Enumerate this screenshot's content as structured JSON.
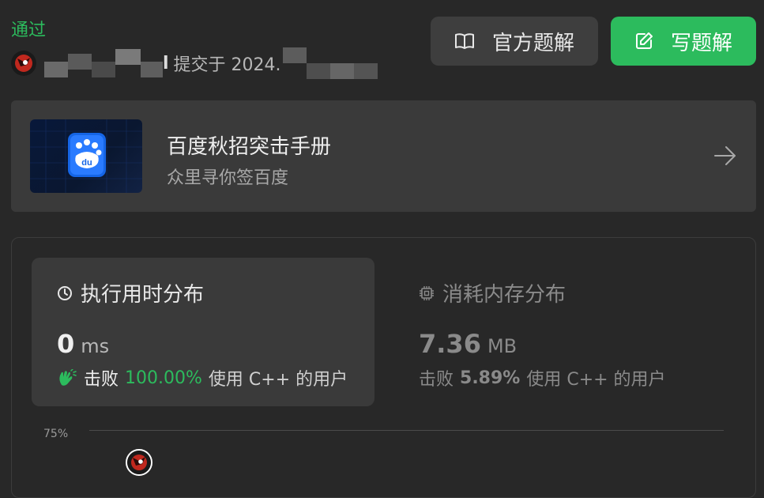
{
  "status": "通过",
  "submission": {
    "prefix": "l",
    "text": "提交于 2024."
  },
  "buttons": {
    "official": "官方题解",
    "write": "写题解"
  },
  "banner": {
    "title": "百度秋招突击手册",
    "subtitle": "众里寻你签百度",
    "logo_text": "du"
  },
  "runtime": {
    "title": "执行用时分布",
    "value": "0",
    "unit": "ms",
    "beat_label": "击败",
    "beat_pct": "100.00%",
    "beat_suffix": "使用 C++ 的用户"
  },
  "memory": {
    "title": "消耗内存分布",
    "value": "7.36",
    "unit": "MB",
    "beat_label": "击败",
    "beat_pct": "5.89%",
    "beat_suffix": "使用 C++ 的用户"
  },
  "chart": {
    "tick": "75%"
  },
  "colors": {
    "accent": "#2cbb5d",
    "background": "#282828",
    "card": "#3a3a3a"
  }
}
